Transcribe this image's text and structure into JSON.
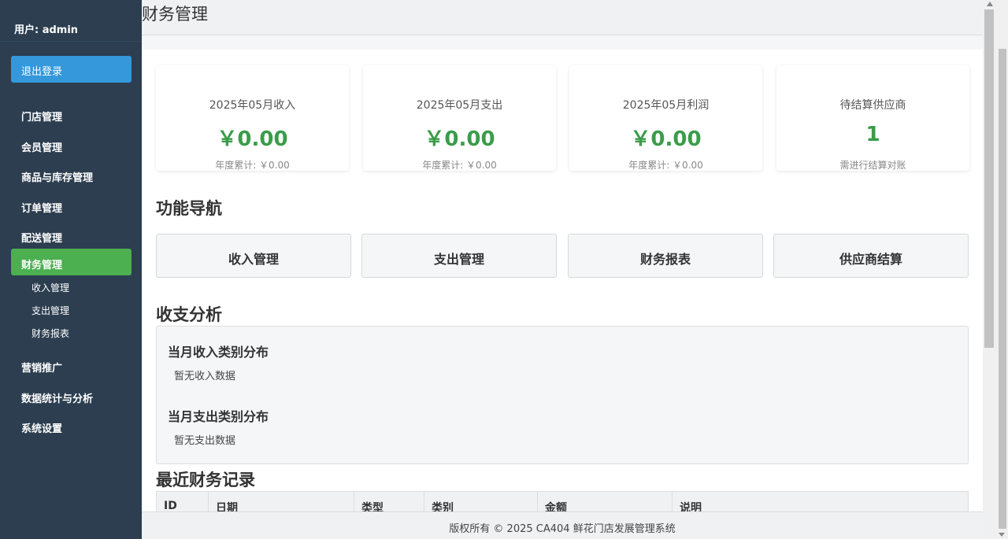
{
  "sidebar": {
    "user_label": "用户: admin",
    "logout_label": "退出登录",
    "nav": [
      {
        "label": "门店管理"
      },
      {
        "label": "会员管理"
      },
      {
        "label": "商品与库存管理"
      },
      {
        "label": "订单管理"
      },
      {
        "label": "配送管理"
      },
      {
        "label": "财务管理"
      },
      {
        "label": "营销推广"
      },
      {
        "label": "数据统计与分析"
      },
      {
        "label": "系统设置"
      }
    ],
    "sub_nav": [
      {
        "label": "收入管理"
      },
      {
        "label": "支出管理"
      },
      {
        "label": "财务报表"
      }
    ],
    "active_color": "#4caf50",
    "logout_color": "#3498db"
  },
  "header": {
    "title": "财务管理"
  },
  "stats": [
    {
      "label": "2025年05月收入",
      "value": "￥0.00",
      "sub": "年度累计: ￥0.00"
    },
    {
      "label": "2025年05月支出",
      "value": "￥0.00",
      "sub": "年度累计: ￥0.00"
    },
    {
      "label": "2025年05月利润",
      "value": "￥0.00",
      "sub": "年度累计: ￥0.00"
    },
    {
      "label": "待结算供应商",
      "value": "1",
      "sub": "需进行结算对账"
    }
  ],
  "functions": {
    "title": "功能导航",
    "buttons": [
      {
        "label": "收入管理"
      },
      {
        "label": "支出管理"
      },
      {
        "label": "财务报表"
      },
      {
        "label": "供应商结算"
      }
    ]
  },
  "analysis": {
    "title": "收支分析",
    "income_title": "当月收入类别分布",
    "income_empty": "暂无收入数据",
    "expense_title": "当月支出类别分布",
    "expense_empty": "暂无支出数据"
  },
  "records": {
    "title": "最近财务记录",
    "columns": [
      "ID",
      "日期",
      "类型",
      "类别",
      "金额",
      "说明"
    ]
  },
  "footer": {
    "text": "版权所有 © 2025 CA404 鲜花门店发展管理系统"
  },
  "accent_value_color": "#3a9c4a"
}
